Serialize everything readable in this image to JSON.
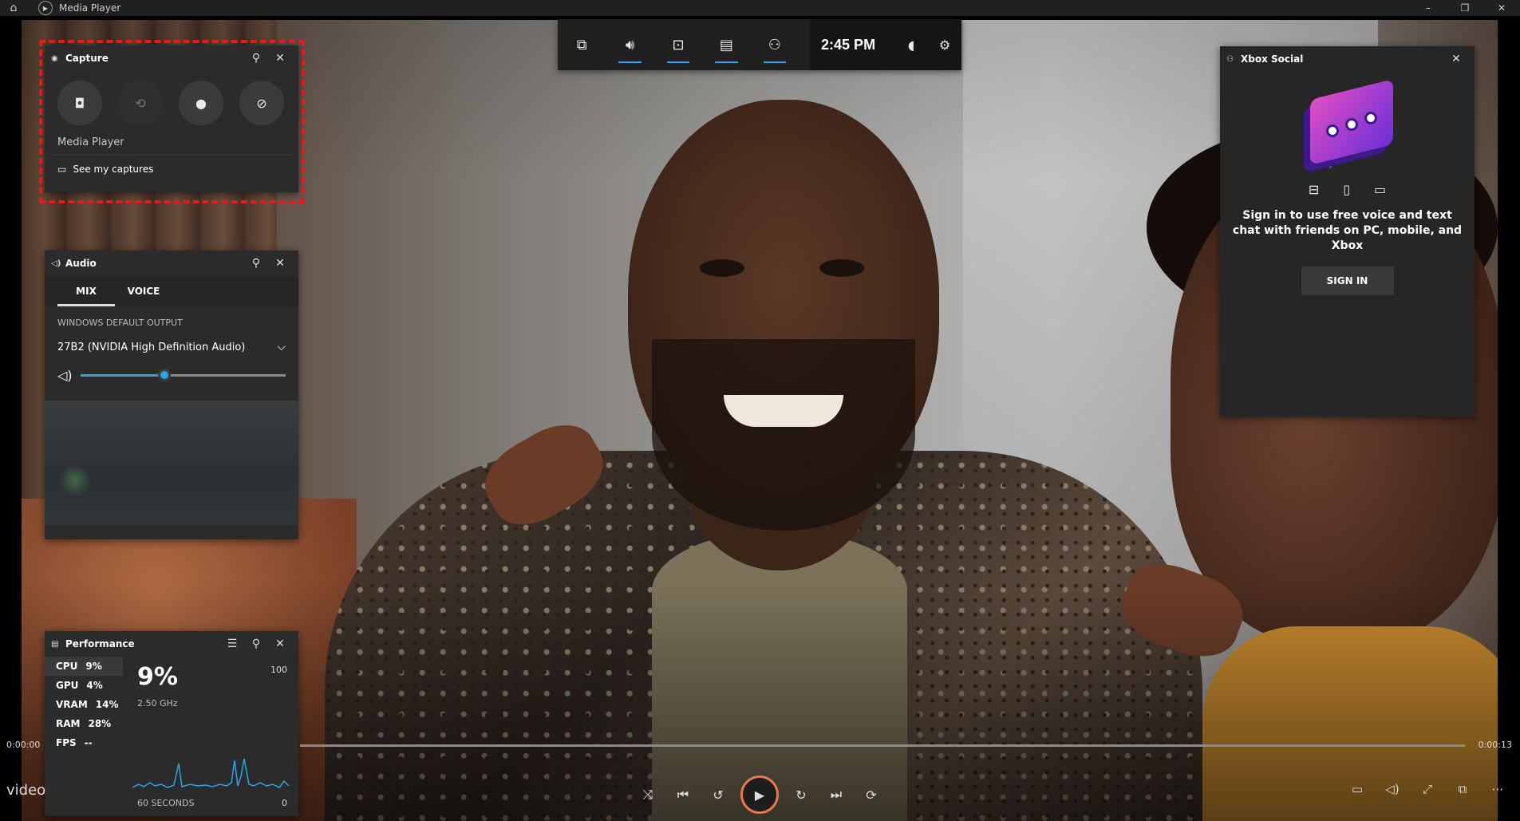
{
  "titlebar": {
    "title": "Media Player",
    "min": "–",
    "restore": "❐",
    "close": "✕"
  },
  "gamebar": {
    "time": "2:45 PM"
  },
  "capture": {
    "title": "Capture",
    "app_name": "Media Player",
    "see_captures": "See my captures"
  },
  "audio": {
    "title": "Audio",
    "tabs": [
      "MIX",
      "VOICE"
    ],
    "section": "WINDOWS DEFAULT OUTPUT",
    "device": "27B2 (NVIDIA High Definition Audio)",
    "volume": 0.41
  },
  "performance": {
    "title": "Performance",
    "rows": [
      {
        "label": "CPU",
        "value": "9%"
      },
      {
        "label": "GPU",
        "value": "4%"
      },
      {
        "label": "VRAM",
        "value": "14%"
      },
      {
        "label": "RAM",
        "value": "28%"
      },
      {
        "label": "FPS",
        "value": "--"
      }
    ],
    "big_value": "9%",
    "freq": "2.50 GHz",
    "max": "100",
    "min": "0",
    "window": "60 SECONDS"
  },
  "social": {
    "title": "Xbox Social",
    "message": "Sign in to use free voice and text chat with friends on PC, mobile, and Xbox",
    "signin": "SIGN IN"
  },
  "player": {
    "time_current": "0:00:00",
    "time_total": "0:00:13",
    "label": "video"
  },
  "colors": {
    "accent": "#2ba5e8",
    "highlight_outline": "#e21b1b",
    "play_ring": "#e9774b"
  }
}
